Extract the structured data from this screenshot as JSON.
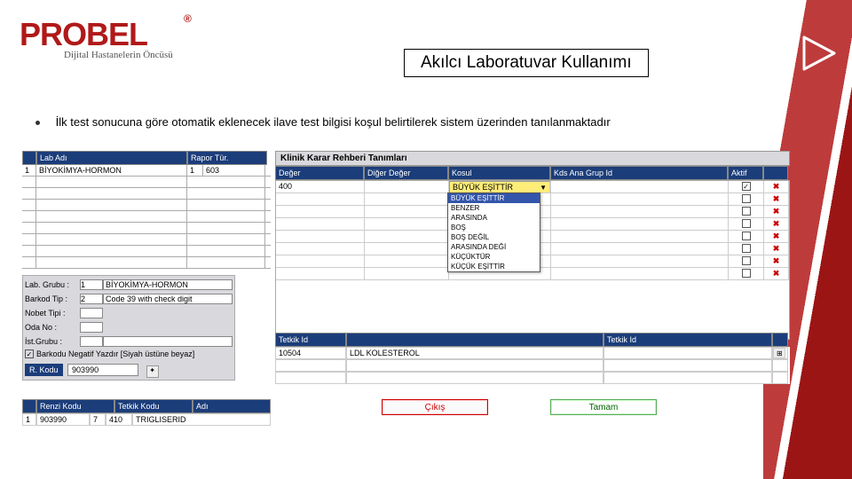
{
  "brand": {
    "name": "PROBEL",
    "reg": "®",
    "tagline": "Dijital Hastanelerin Öncüsü"
  },
  "page_title": "Akılcı Laboratuvar Kullanımı",
  "bullet": "İlk test sonucuna göre otomatik eklenecek ilave test bilgisi koşul belirtilerek sistem üzerinden tanılanmaktadır",
  "left_header": {
    "col1": "Lab Adı",
    "col2": "Rapor Tür."
  },
  "left_rows": [
    {
      "n": "1",
      "name": "BİYOKİMYA-HORMON",
      "rt1": "1",
      "rt2": "603"
    }
  ],
  "form": {
    "l_group": "Lab. Grubu :",
    "v_group_n": "1",
    "v_group_t": "BİYOKİMYA-HORMON",
    "l_barkod": "Barkod Tip :",
    "v_barkod_n": "2",
    "v_barkod_t": "Code 39 with check digit",
    "l_nobet": "Nobet Tipi :",
    "l_oda": "Oda No :",
    "l_ist": "İst.Grubu :",
    "check_label": "Barkodu Negatif Yazdır [Siyah üstüne beyaz]",
    "rkodu": "R. Kodu",
    "rkodu_val": "903990"
  },
  "left_bottom_hdr": {
    "c1": "Renzi Kodu",
    "c2": "Tetkik Kodu",
    "c3": "Adı"
  },
  "left_bottom_row": {
    "n": "1",
    "rk": "903990",
    "tk1": "7",
    "tk2": "410",
    "name": "TRIGLISERID"
  },
  "right_title": "Klinik Karar Rehberi Tanımları",
  "right_hdr": {
    "c1": "Değer",
    "c2": "Diğer Değer",
    "c3": "Kosul",
    "c4": "Kds Ana Grup Id",
    "c5": "Aktif"
  },
  "right_row": {
    "deger": "400",
    "kosul_sel": "BÜYÜK EŞİTTİR"
  },
  "dropdown": [
    "BÜYÜK EŞİTTİR",
    "BENZER",
    "ARASINDA",
    "BOŞ",
    "BOŞ DEĞİL",
    "ARASINDA DEĞİ",
    "KÜÇÜKTÜR",
    "KÜÇÜK EŞİTTİR"
  ],
  "tet_hdr": {
    "c1": "Tetkik Id",
    "c2": "",
    "c3": "Tetkik Id"
  },
  "tet_row": {
    "id": "10504",
    "name": "LDL KOLESTEROL"
  },
  "buttons": {
    "cikis": "Çıkış",
    "tamam": "Tamam"
  }
}
